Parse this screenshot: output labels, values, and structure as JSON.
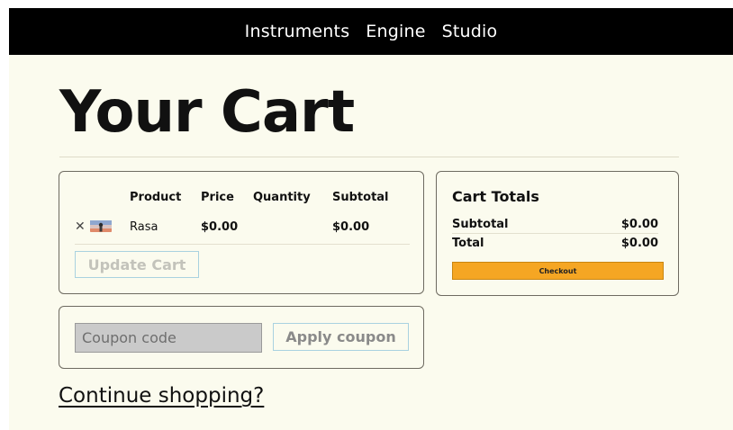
{
  "nav": {
    "items": [
      "Instruments",
      "Engine",
      "Studio"
    ]
  },
  "page": {
    "title": "Your Cart"
  },
  "cart": {
    "headers": {
      "product": "Product",
      "price": "Price",
      "quantity": "Quantity",
      "subtotal": "Subtotal"
    },
    "items": [
      {
        "remove_glyph": "✕",
        "thumbnail_icon": "product-thumbnail-icon",
        "product": "Rasa",
        "price": "$0.00",
        "quantity": "",
        "subtotal": "$0.00"
      }
    ],
    "update_label": "Update Cart"
  },
  "totals": {
    "title": "Cart Totals",
    "subtotal_label": "Subtotal",
    "subtotal_value": "$0.00",
    "total_label": "Total",
    "total_value": "$0.00",
    "checkout_label": "Checkout",
    "checkout_color": "#f5a623"
  },
  "coupon": {
    "placeholder": "Coupon code",
    "value": "",
    "apply_label": "Apply coupon"
  },
  "continue_label": "Continue shopping?"
}
